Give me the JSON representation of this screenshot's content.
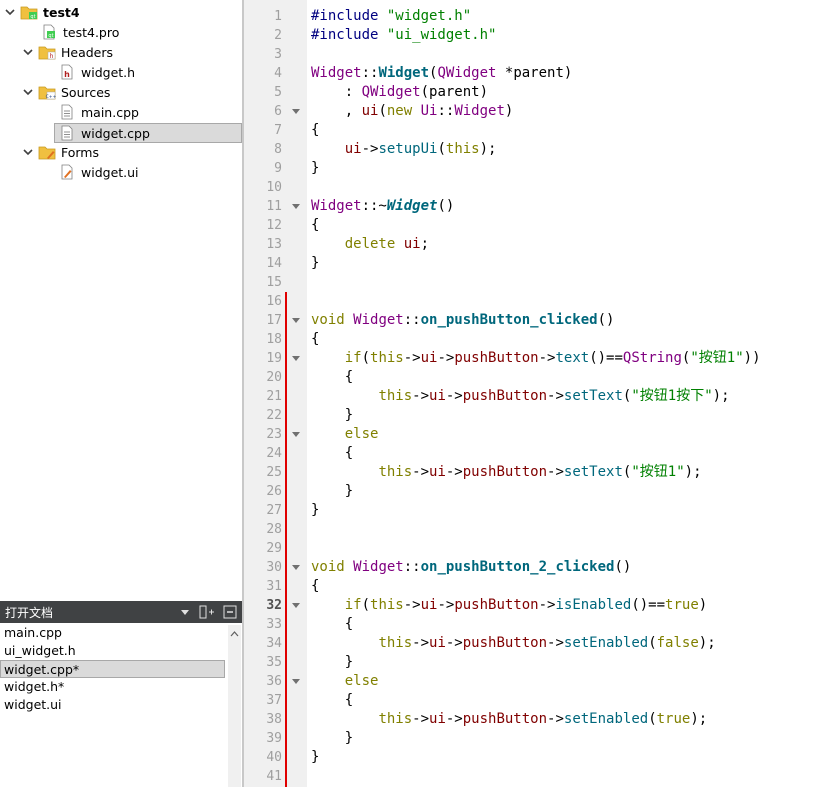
{
  "project_tree": {
    "project": "test4",
    "pro_file": "test4.pro",
    "headers_label": "Headers",
    "header_file": "widget.h",
    "sources_label": "Sources",
    "source_files": [
      "main.cpp",
      "widget.cpp"
    ],
    "forms_label": "Forms",
    "form_file": "widget.ui"
  },
  "open_documents": {
    "title": "打开文档",
    "items": [
      "main.cpp",
      "ui_widget.h",
      "widget.cpp*",
      "widget.h*",
      "widget.ui"
    ],
    "selected": "widget.cpp*"
  },
  "editor": {
    "current_line": 32,
    "line_numbers": [
      "1",
      "2",
      "3",
      "4",
      "5",
      "6",
      "7",
      "8",
      "9",
      "10",
      "11",
      "12",
      "13",
      "14",
      "15",
      "16",
      "17",
      "18",
      "19",
      "20",
      "21",
      "22",
      "23",
      "24",
      "25",
      "26",
      "27",
      "28",
      "29",
      "30",
      "31",
      "32",
      "33",
      "34",
      "35",
      "36",
      "37",
      "38",
      "39",
      "40",
      "41"
    ],
    "fold_lines": [
      6,
      11,
      17,
      19,
      23,
      30,
      32,
      36
    ],
    "code": [
      [
        [
          "pp",
          "#include "
        ],
        [
          "str",
          "\"widget.h\""
        ]
      ],
      [
        [
          "pp",
          "#include "
        ],
        [
          "str",
          "\"ui_widget.h\""
        ]
      ],
      [],
      [
        [
          "cls",
          "Widget"
        ],
        [
          "op",
          "::"
        ],
        [
          "fnb",
          "Widget"
        ],
        [
          "op",
          "("
        ],
        [
          "cls",
          "QWidget"
        ],
        [
          "op",
          " *"
        ],
        [
          "op",
          "parent)"
        ]
      ],
      [
        [
          "op",
          "    : "
        ],
        [
          "cls",
          "QWidget"
        ],
        [
          "op",
          "(parent)"
        ]
      ],
      [
        [
          "op",
          "    , "
        ],
        [
          "mem",
          "ui"
        ],
        [
          "op",
          "("
        ],
        [
          "kw",
          "new"
        ],
        [
          "op",
          " "
        ],
        [
          "cls",
          "Ui"
        ],
        [
          "op",
          "::"
        ],
        [
          "cls",
          "Widget"
        ],
        [
          "op",
          ")"
        ]
      ],
      [
        [
          "op",
          "{"
        ]
      ],
      [
        [
          "op",
          "    "
        ],
        [
          "mem",
          "ui"
        ],
        [
          "op",
          "->"
        ],
        [
          "fn",
          "setupUi"
        ],
        [
          "op",
          "("
        ],
        [
          "kw",
          "this"
        ],
        [
          "op",
          ");"
        ]
      ],
      [
        [
          "op",
          "}"
        ]
      ],
      [],
      [
        [
          "cls",
          "Widget"
        ],
        [
          "op",
          "::~"
        ],
        [
          "dtor",
          "Widget"
        ],
        [
          "op",
          "()"
        ]
      ],
      [
        [
          "op",
          "{"
        ]
      ],
      [
        [
          "op",
          "    "
        ],
        [
          "kw",
          "delete"
        ],
        [
          "op",
          " "
        ],
        [
          "mem",
          "ui"
        ],
        [
          "op",
          ";"
        ]
      ],
      [
        [
          "op",
          "}"
        ]
      ],
      [],
      [],
      [
        [
          "kw",
          "void"
        ],
        [
          "op",
          " "
        ],
        [
          "cls",
          "Widget"
        ],
        [
          "op",
          "::"
        ],
        [
          "fnb",
          "on_pushButton_clicked"
        ],
        [
          "op",
          "()"
        ]
      ],
      [
        [
          "op",
          "{"
        ]
      ],
      [
        [
          "op",
          "    "
        ],
        [
          "kw",
          "if"
        ],
        [
          "op",
          "("
        ],
        [
          "kw",
          "this"
        ],
        [
          "op",
          "->"
        ],
        [
          "mem",
          "ui"
        ],
        [
          "op",
          "->"
        ],
        [
          "mem",
          "pushButton"
        ],
        [
          "op",
          "->"
        ],
        [
          "fn",
          "text"
        ],
        [
          "op",
          "()=="
        ],
        [
          "cls",
          "QString"
        ],
        [
          "op",
          "("
        ],
        [
          "str",
          "\"按钮1\""
        ],
        [
          "op",
          "))"
        ]
      ],
      [
        [
          "op",
          "    {"
        ]
      ],
      [
        [
          "op",
          "        "
        ],
        [
          "kw",
          "this"
        ],
        [
          "op",
          "->"
        ],
        [
          "mem",
          "ui"
        ],
        [
          "op",
          "->"
        ],
        [
          "mem",
          "pushButton"
        ],
        [
          "op",
          "->"
        ],
        [
          "fn",
          "setText"
        ],
        [
          "op",
          "("
        ],
        [
          "str",
          "\"按钮1按下\""
        ],
        [
          "op",
          ");"
        ]
      ],
      [
        [
          "op",
          "    }"
        ]
      ],
      [
        [
          "op",
          "    "
        ],
        [
          "kw",
          "else"
        ]
      ],
      [
        [
          "op",
          "    {"
        ]
      ],
      [
        [
          "op",
          "        "
        ],
        [
          "kw",
          "this"
        ],
        [
          "op",
          "->"
        ],
        [
          "mem",
          "ui"
        ],
        [
          "op",
          "->"
        ],
        [
          "mem",
          "pushButton"
        ],
        [
          "op",
          "->"
        ],
        [
          "fn",
          "setText"
        ],
        [
          "op",
          "("
        ],
        [
          "str",
          "\"按钮1\""
        ],
        [
          "op",
          ");"
        ]
      ],
      [
        [
          "op",
          "    }"
        ]
      ],
      [
        [
          "op",
          "}"
        ]
      ],
      [],
      [],
      [
        [
          "kw",
          "void"
        ],
        [
          "op",
          " "
        ],
        [
          "cls",
          "Widget"
        ],
        [
          "op",
          "::"
        ],
        [
          "fnb",
          "on_pushButton_2_clicked"
        ],
        [
          "op",
          "()"
        ]
      ],
      [
        [
          "op",
          "{"
        ]
      ],
      [
        [
          "op",
          "    "
        ],
        [
          "kw",
          "if"
        ],
        [
          "op",
          "("
        ],
        [
          "kw",
          "this"
        ],
        [
          "op",
          "->"
        ],
        [
          "mem",
          "ui"
        ],
        [
          "op",
          "->"
        ],
        [
          "mem",
          "pushButton"
        ],
        [
          "op",
          "->"
        ],
        [
          "fn",
          "isEnabled"
        ],
        [
          "op",
          "()=="
        ],
        [
          "kw",
          "true"
        ],
        [
          "op",
          ")"
        ]
      ],
      [
        [
          "op",
          "    {"
        ]
      ],
      [
        [
          "op",
          "        "
        ],
        [
          "kw",
          "this"
        ],
        [
          "op",
          "->"
        ],
        [
          "mem",
          "ui"
        ],
        [
          "op",
          "->"
        ],
        [
          "mem",
          "pushButton"
        ],
        [
          "op",
          "->"
        ],
        [
          "fn",
          "setEnabled"
        ],
        [
          "op",
          "("
        ],
        [
          "kw",
          "false"
        ],
        [
          "op",
          ");"
        ]
      ],
      [
        [
          "op",
          "    }"
        ]
      ],
      [
        [
          "op",
          "    "
        ],
        [
          "kw",
          "else"
        ]
      ],
      [
        [
          "op",
          "    {"
        ]
      ],
      [
        [
          "op",
          "        "
        ],
        [
          "kw",
          "this"
        ],
        [
          "op",
          "->"
        ],
        [
          "mem",
          "ui"
        ],
        [
          "op",
          "->"
        ],
        [
          "mem",
          "pushButton"
        ],
        [
          "op",
          "->"
        ],
        [
          "fn",
          "setEnabled"
        ],
        [
          "op",
          "("
        ],
        [
          "kw",
          "true"
        ],
        [
          "op",
          ");"
        ]
      ],
      [
        [
          "op",
          "    }"
        ]
      ],
      [
        [
          "op",
          "}"
        ]
      ],
      []
    ]
  },
  "colors": {
    "preprocessor": "#000080",
    "string": "#008000",
    "class": "#800080",
    "keyword": "#808000",
    "function": "#00677c",
    "member": "#800000",
    "change_marker": "#e00000"
  },
  "icons": {
    "project": "qt-project-icon",
    "pro_file": "qt-pro-file-icon",
    "headers": "headers-folder-icon",
    "header_file": "header-file-icon",
    "sources": "sources-folder-icon",
    "source_file": "cpp-file-icon",
    "forms": "forms-folder-icon",
    "form_file": "ui-file-icon"
  }
}
